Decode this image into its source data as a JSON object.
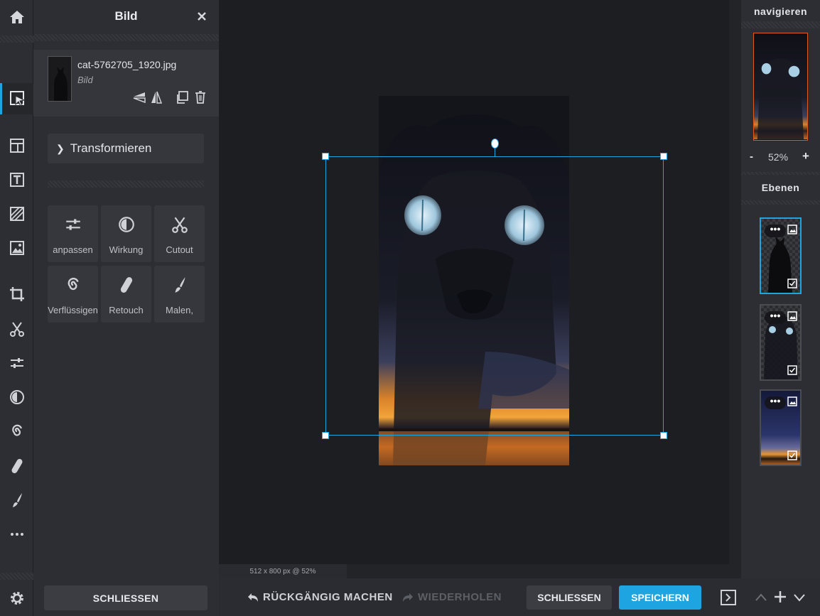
{
  "panel": {
    "title": "Bild",
    "layer": {
      "filename": "cat-5762705_1920.jpg",
      "type": "Bild"
    },
    "transform_label": "Transformieren",
    "tools": [
      {
        "label": "anpassen",
        "icon": "sliders-icon"
      },
      {
        "label": "Wirkung",
        "icon": "half-circle-icon"
      },
      {
        "label": "Cutout",
        "icon": "scissors-icon"
      },
      {
        "label": "Verflüssigen",
        "icon": "spiral-icon"
      },
      {
        "label": "Retouch",
        "icon": "bandage-icon"
      },
      {
        "label": "Malen,",
        "icon": "brush-icon"
      }
    ],
    "close_label": "SCHLIESSEN"
  },
  "rail": {
    "icons": [
      "home-icon",
      "select-arrow-icon",
      "template-icon",
      "text-icon",
      "pattern-icon",
      "image-icon",
      "crop-icon",
      "scissors-icon",
      "sliders-icon",
      "half-circle-icon",
      "spiral-icon",
      "bandage-icon",
      "brush-icon",
      "more-icon",
      "gear-icon"
    ]
  },
  "canvas": {
    "status": "512 x 800 px @ 52%"
  },
  "bottombar": {
    "undo_label": "RÜCKGÄNGIG MACHEN",
    "redo_label": "WIEDERHOLEN",
    "close_label": "SCHLIESSEN",
    "save_label": "SPEICHERN"
  },
  "navigator": {
    "title": "navigieren",
    "zoom_out": "-",
    "zoom": "52%",
    "zoom_in": "+"
  },
  "layers": {
    "title": "Ebenen"
  },
  "colors": {
    "accent": "#1ea4e0",
    "nav_frame": "#e05a1e",
    "panel_bg": "#2c2e33",
    "canvas_bg": "#1d1e21"
  }
}
